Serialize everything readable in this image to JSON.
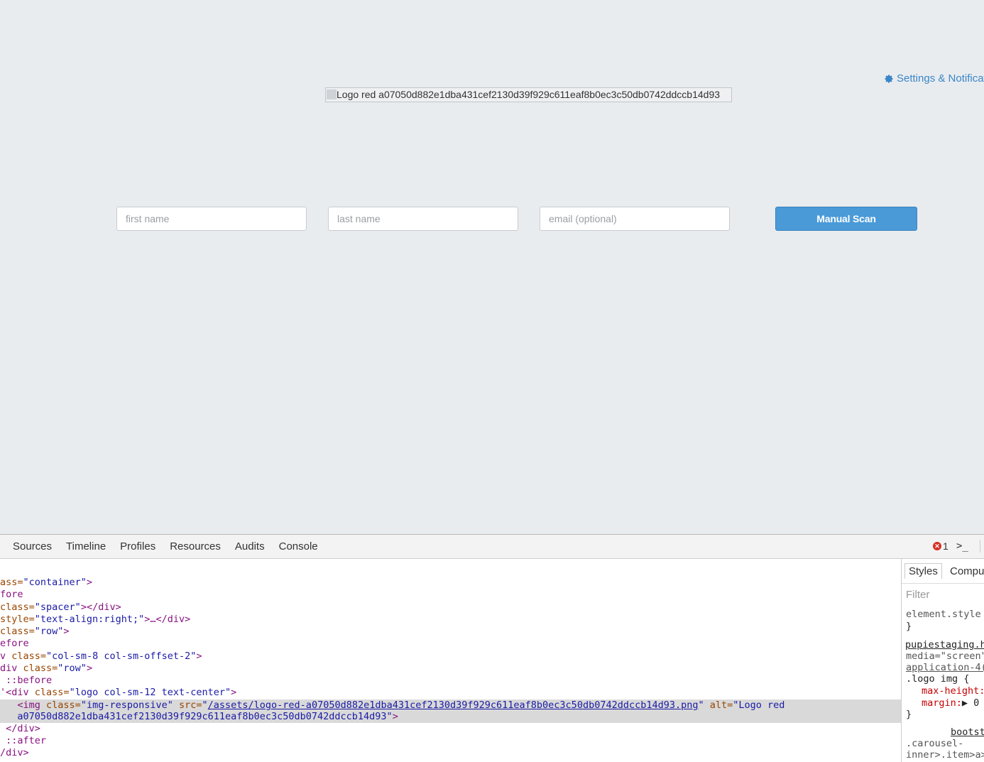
{
  "page": {
    "settings_link": "Settings & Notificati",
    "logo_alt": "Logo red a07050d882e1dba431cef2130d39f929c611eaf8b0ec3c50db0742ddccb14d93",
    "form": {
      "first_name_placeholder": "first name",
      "last_name_placeholder": "last name",
      "email_placeholder": "email (optional)",
      "submit_label": "Manual Scan"
    }
  },
  "devtools": {
    "tabs": [
      "Sources",
      "Timeline",
      "Profiles",
      "Resources",
      "Audits",
      "Console"
    ],
    "error_count": "1",
    "console_icon": ">_",
    "code": {
      "l1_a": "ass=",
      "l1_v": "\"container\"",
      "l1_c": ">",
      "l2": "fore",
      "l3_a": "class=",
      "l3_v": "\"spacer\"",
      "l3_c": "></div>",
      "l4_a": "style=",
      "l4_v": "\"text-align:right;\"",
      "l4_c": ">…</div>",
      "l5_a": "class=",
      "l5_v": "\"row\"",
      "l5_c": ">",
      "l6": "efore",
      "l7_t": "v ",
      "l7_a": "class=",
      "l7_v": "\"col-sm-8 col-sm-offset-2\"",
      "l7_c": ">",
      "l8_t": "div ",
      "l8_a": "class=",
      "l8_v": "\"row\"",
      "l8_c": ">",
      "l9": " ::before",
      "l10_t": "'<div ",
      "l10_a": "class=",
      "l10_v": "\"logo col-sm-12 text-center\"",
      "l10_c": ">",
      "l11_t": "   <img ",
      "l11_a1": "class=",
      "l11_v1": "\"img-responsive\"",
      "l11_a2": " src=",
      "l11_q1": "\"",
      "l11_link": "/assets/logo-red-a07050d882e1dba431cef2130d39f929c611eaf8b0ec3c50db0742ddccb14d93.png",
      "l11_q2": "\"",
      "l11_a3": " alt=",
      "l11_v3": "\"Logo red",
      "l12_v": "   a07050d882e1dba431cef2130d39f929c611eaf8b0ec3c50db0742ddccb14d93\"",
      "l12_c": ">",
      "l13": " </div>",
      "l14": " ::after",
      "l15": "/div>"
    },
    "sidebar": {
      "tab_styles": "Styles",
      "tab_computed": "Compu",
      "filter": "Filter",
      "element_style": "element.style",
      "close1": "}",
      "source_link": "pupiestaging.h",
      "media": "media=\"screen\"",
      "source_link2": "application-4(",
      "selector": ".logo img {",
      "prop1": "max-height:",
      "prop2": "margin:",
      "prop2_val": "▶ 0",
      "close2": "}",
      "bootstrap": "bootst",
      "rule2a": ".carousel-",
      "rule2b": "inner>.item>a>"
    }
  }
}
